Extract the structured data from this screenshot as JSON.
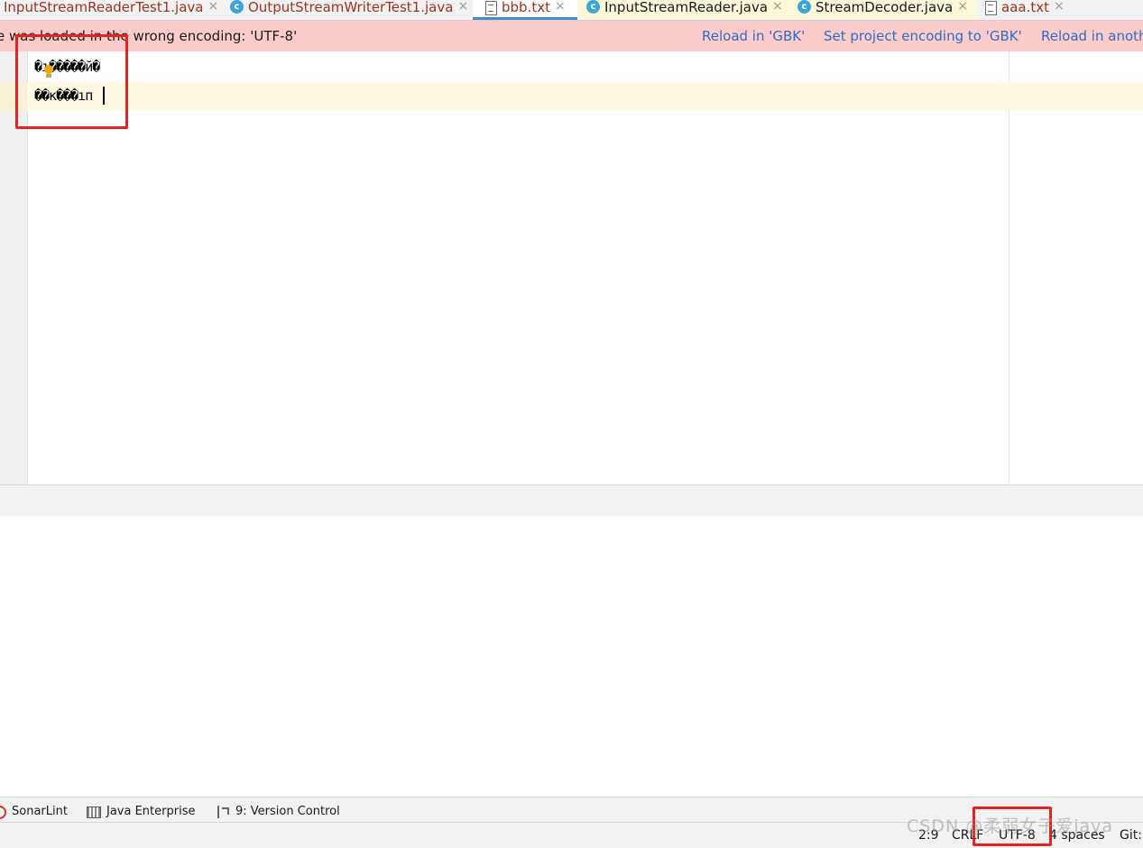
{
  "tabs": [
    {
      "label": "InputStreamReaderTest1.java",
      "icon": "none",
      "kind": "java"
    },
    {
      "label": "OutputStreamWriterTest1.java",
      "icon": "class-icon",
      "kind": "java"
    },
    {
      "label": "bbb.txt",
      "icon": "text-file-icon",
      "kind": "txt",
      "active": true
    },
    {
      "label": "InputStreamReader.java",
      "icon": "class-icon",
      "kind": "lib"
    },
    {
      "label": "StreamDecoder.java",
      "icon": "class-icon",
      "kind": "lib"
    },
    {
      "label": "aaa.txt",
      "icon": "text-file-icon",
      "kind": "txt"
    }
  ],
  "tab_close": "×",
  "class_icon_glyph": "c",
  "notice": {
    "message": "e was loaded in the wrong encoding: 'UTF-8'",
    "actions": [
      "Reload in 'GBK'",
      "Set project encoding to 'GBK'",
      "Reload in anoth"
    ]
  },
  "editor": {
    "lines": [
      "�ı�����й�",
      "��к���ıп"
    ]
  },
  "tool_windows": [
    {
      "label": "SonarLint",
      "icon": "sonarlint-icon"
    },
    {
      "label": "Java Enterprise",
      "icon": "java-enterprise-icon"
    },
    {
      "label": "9: Version Control",
      "icon": "version-control-icon"
    }
  ],
  "status": {
    "position": "2:9",
    "line_separator": "CRLF",
    "encoding": "UTF-8",
    "indent": "4 spaces",
    "vcs": "Git:"
  },
  "watermark": "CSDN @柔弱女子爱java",
  "colors": {
    "notice_bg": "#fccccc",
    "link": "#2c6fc2",
    "highlight_box": "#e8221d",
    "current_line": "#fdf9e3"
  }
}
